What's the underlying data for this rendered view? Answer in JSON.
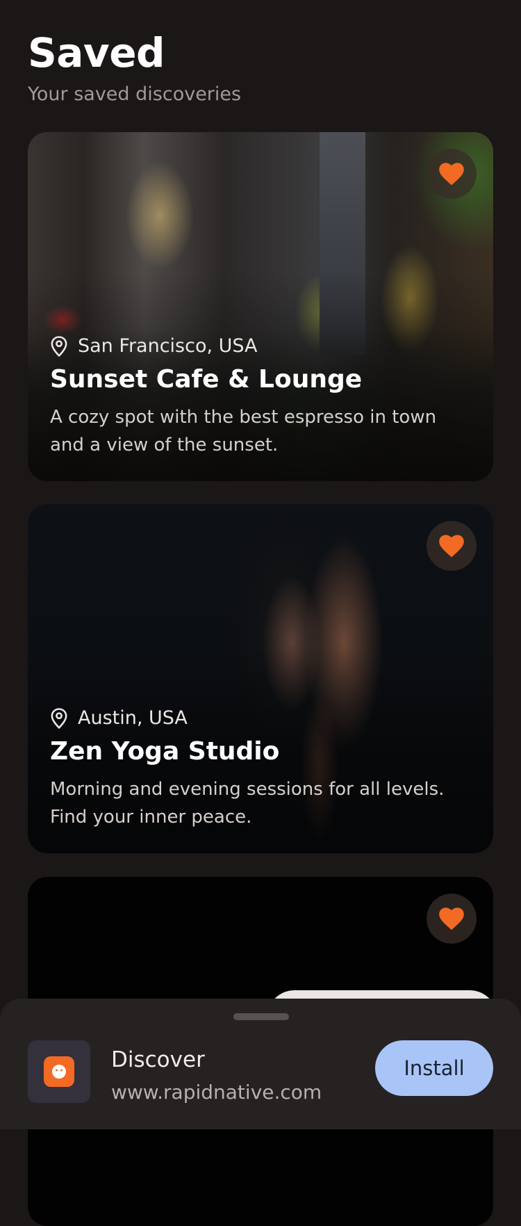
{
  "header": {
    "title": "Saved",
    "subtitle": "Your saved discoveries"
  },
  "cards": [
    {
      "location": "San Francisco, USA",
      "title": "Sunset Cafe & Lounge",
      "description": "A cozy spot with the best espresso in town and a view of the sunset.",
      "image": "cafe-patio-night-photo",
      "favorited": true
    },
    {
      "location": "Austin, USA",
      "title": "Zen Yoga Studio",
      "description": "Morning and evening sessions for all levels. Find your inner peace.",
      "image": "athlete-tank-top-photo",
      "favorited": true
    },
    {
      "location": "",
      "title": "",
      "description": "",
      "image": "dark-photo",
      "favorited": true
    }
  ],
  "install_banner": {
    "app_name": "Discover",
    "url": "www.rapidnative.com",
    "install_label": "Install",
    "icon": "app-logo-icon"
  },
  "colors": {
    "accent": "#f26a23",
    "background": "#1b1716",
    "install_button": "#a9c5f7"
  }
}
